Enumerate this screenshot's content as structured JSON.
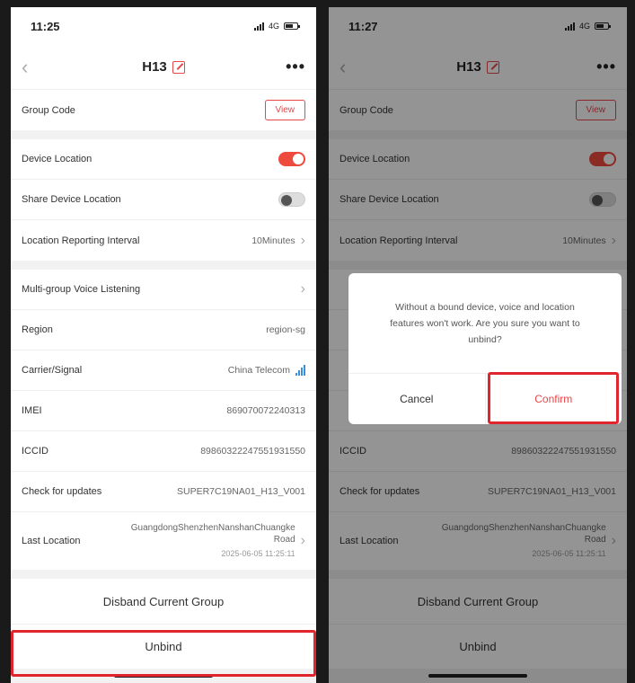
{
  "left": {
    "status": {
      "time": "11:25",
      "network": "4G"
    },
    "nav": {
      "title": "H13"
    },
    "group_code": {
      "label": "Group Code",
      "button": "View"
    },
    "device_location": {
      "label": "Device Location",
      "enabled": true
    },
    "share_location": {
      "label": "Share Device Location",
      "enabled": false
    },
    "reporting_interval": {
      "label": "Location Reporting Interval",
      "value": "10Minutes"
    },
    "voice_listening": {
      "label": "Multi-group Voice Listening"
    },
    "region": {
      "label": "Region",
      "value": "region-sg"
    },
    "carrier": {
      "label": "Carrier/Signal",
      "value": "China Telecom"
    },
    "imei": {
      "label": "IMEI",
      "value": "869070072240313"
    },
    "iccid": {
      "label": "ICCID",
      "value": "89860322247551931550"
    },
    "updates": {
      "label": "Check for updates",
      "value": "SUPER7C19NA01_H13_V001"
    },
    "last_location": {
      "label": "Last Location",
      "value": "GuangdongShenzhenNanshanChuangke Road",
      "time": "2025-06-05 11:25:11"
    },
    "disband_label": "Disband Current Group",
    "unbind_label": "Unbind"
  },
  "right": {
    "status": {
      "time": "11:27",
      "network": "4G"
    },
    "nav": {
      "title": "H13"
    },
    "group_code": {
      "label": "Group Code",
      "button": "View"
    },
    "device_location": {
      "label": "Device Location",
      "enabled": true
    },
    "share_location": {
      "label": "Share Device Location",
      "enabled": false
    },
    "reporting_interval": {
      "label": "Location Reporting Interval",
      "value": "10Minutes"
    },
    "iccid": {
      "label": "ICCID",
      "value": "89860322247551931550"
    },
    "updates": {
      "label": "Check for updates",
      "value": "SUPER7C19NA01_H13_V001"
    },
    "last_location": {
      "label": "Last Location",
      "value": "GuangdongShenzhenNanshanChuangke Road",
      "time": "2025-06-05 11:25:11"
    },
    "disband_label": "Disband Current Group",
    "unbind_label": "Unbind",
    "dialog": {
      "message": "Without a bound device, voice and location features won't work. Are you sure you want to unbind?",
      "cancel": "Cancel",
      "confirm": "Confirm"
    }
  },
  "colors": {
    "accent": "#e8474a",
    "highlight": "#e0252e",
    "signal": "#3a8fd8"
  }
}
